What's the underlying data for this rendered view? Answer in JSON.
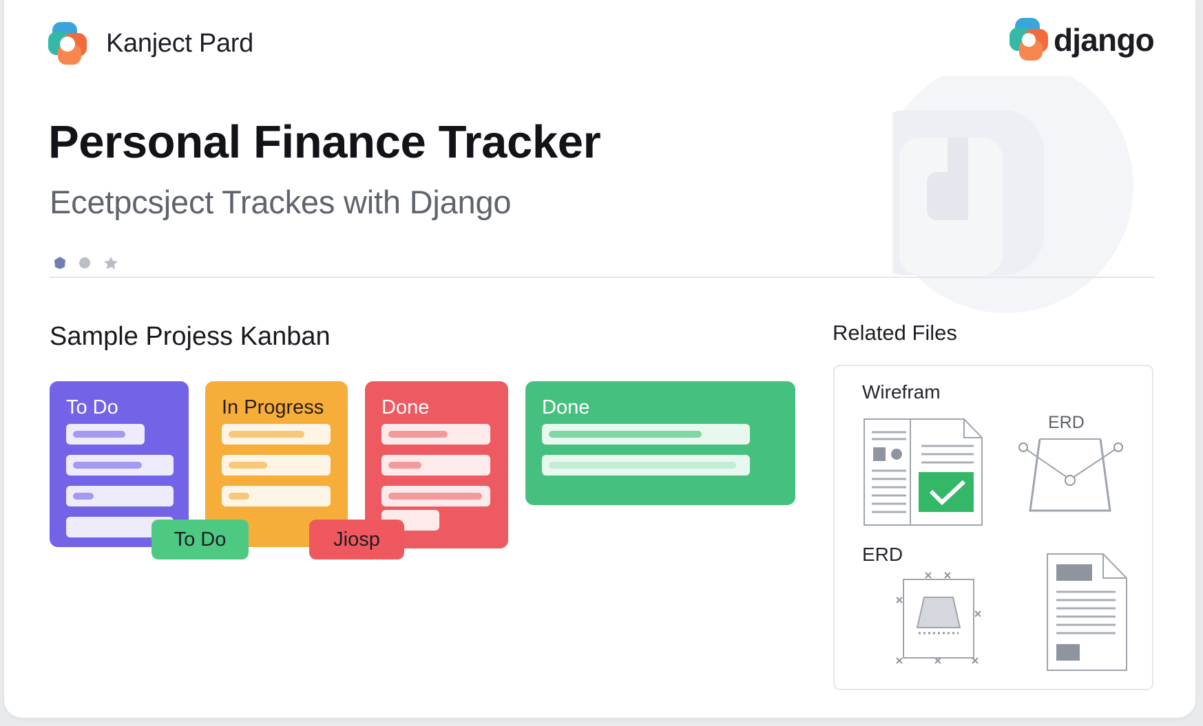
{
  "header": {
    "brand_name": "Kanject Pard",
    "framework_logo_text": "django"
  },
  "hero": {
    "title": "Personal Finance Tracker",
    "subtitle": "Ecetpcsject Trackes with Django"
  },
  "kanban": {
    "heading": "Sample Projess Kanban",
    "columns": [
      {
        "label": "To Do",
        "color": "#7363e6"
      },
      {
        "label": "In Progress",
        "color": "#f6ad3a"
      },
      {
        "label": "Done",
        "color": "#ee5a61"
      },
      {
        "label": "Done",
        "color": "#46c07f"
      }
    ],
    "tags": [
      {
        "label": "To Do",
        "color": "#4ec982"
      },
      {
        "label": "Jiosp",
        "color": "#f0585f"
      }
    ]
  },
  "related_files": {
    "heading": "Related Files",
    "items": [
      {
        "label": "Wirefram",
        "icon": "wireframe-doc-icon"
      },
      {
        "label": "ERD",
        "icon": "erd-diagram-icon"
      },
      {
        "label": "ERD",
        "icon": "erd-shape-icon"
      },
      {
        "label": "",
        "icon": "document-icon"
      }
    ]
  },
  "colors": {
    "accent_teal": "#36b8a8",
    "accent_orange": "#f26b3a"
  }
}
